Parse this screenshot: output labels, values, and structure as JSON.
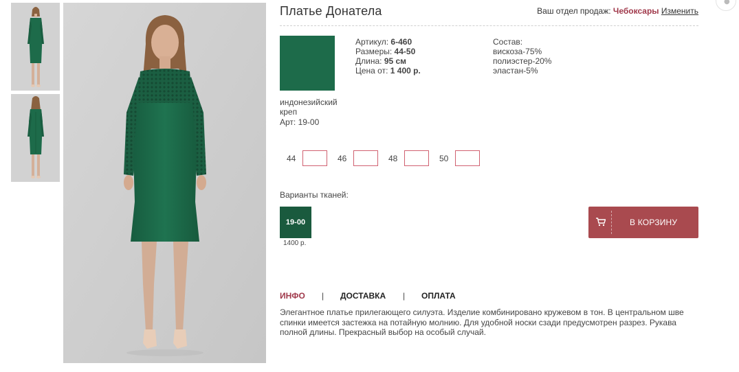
{
  "product": {
    "title": "Платье Донатела"
  },
  "header": {
    "sales_prefix": "Ваш отдел продаж:",
    "city": "Чебоксары",
    "change_link": "Изменить"
  },
  "fabric": {
    "name": "индонезийский креп",
    "article": "Арт: 19-00",
    "color": "#1d6b4a"
  },
  "specs": {
    "article_label": "Артикул:",
    "article_value": "6-460",
    "sizes_label": "Размеры:",
    "sizes_value": "44-50",
    "length_label": "Длина:",
    "length_value": "95 см",
    "price_label": "Цена от:",
    "price_value": "1 400 р."
  },
  "composition": {
    "title": "Состав:",
    "items": [
      "вискоза-75%",
      "полиэстер-20%",
      "эластан-5%"
    ]
  },
  "sizes": [
    {
      "label": "44",
      "value": ""
    },
    {
      "label": "46",
      "value": ""
    },
    {
      "label": "48",
      "value": ""
    },
    {
      "label": "50",
      "value": ""
    }
  ],
  "variants": {
    "label": "Варианты тканей:",
    "items": [
      {
        "code": "19-00",
        "price": "1400 р.",
        "color": "#1a5a3e"
      }
    ]
  },
  "cart": {
    "label": "В КОРЗИНУ",
    "color": "#a94a4f"
  },
  "tabs": [
    {
      "label": "ИНФО",
      "active": true
    },
    {
      "label": "ДОСТАВКА",
      "active": false
    },
    {
      "label": "ОПЛАТА",
      "active": false
    }
  ],
  "tab_separator": "|",
  "description": "Элегантное платье прилегающего силуэта. Изделие комбинировано кружевом в тон. В центральном шве спинки имеется застежка на потайную молнию. Для удобной носки сзади предусмотрен разрез. Рукава полной длины. Прекрасный выбор на особый случай.",
  "colors": {
    "accent": "#a0394b",
    "dress": "#1d6b4a",
    "photo_bg": "#cfcfcf"
  }
}
